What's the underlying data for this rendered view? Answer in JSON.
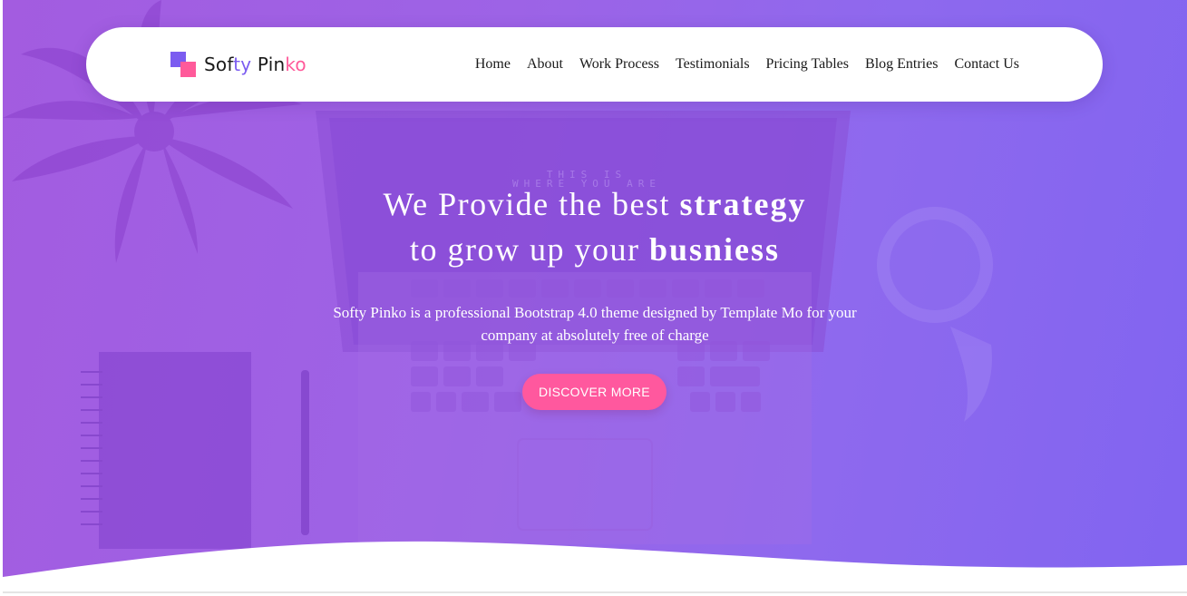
{
  "brand": {
    "part1": "Sof",
    "part2": "ty",
    "part3": " Pin",
    "part4": "ko",
    "colors": {
      "dark": "#1a1a1a",
      "purple": "#7b5cf0",
      "pink": "#ff5a9a"
    }
  },
  "nav": {
    "items": [
      {
        "label": "Home"
      },
      {
        "label": "About"
      },
      {
        "label": "Work Process"
      },
      {
        "label": "Testimonials"
      },
      {
        "label": "Pricing Tables"
      },
      {
        "label": "Blog Entries"
      },
      {
        "label": "Contact Us"
      }
    ]
  },
  "hero": {
    "line1_pre": "We Provide the best ",
    "line1_bold": "strategy",
    "line2_pre": "to grow up your ",
    "line2_bold": "busniess",
    "subtitle": "Softy Pinko is a professional Bootstrap 4.0 theme designed by Template Mo for your company at absolutely free of charge",
    "cta_label": "DISCOVER MORE",
    "laptop_screen_text_line1": "THIS IS",
    "laptop_screen_text_line2": "WHERE YOU ARE",
    "colors": {
      "gradient_start": "#a35ce0",
      "gradient_end": "#8164f0",
      "cta": "#ff589e"
    }
  }
}
